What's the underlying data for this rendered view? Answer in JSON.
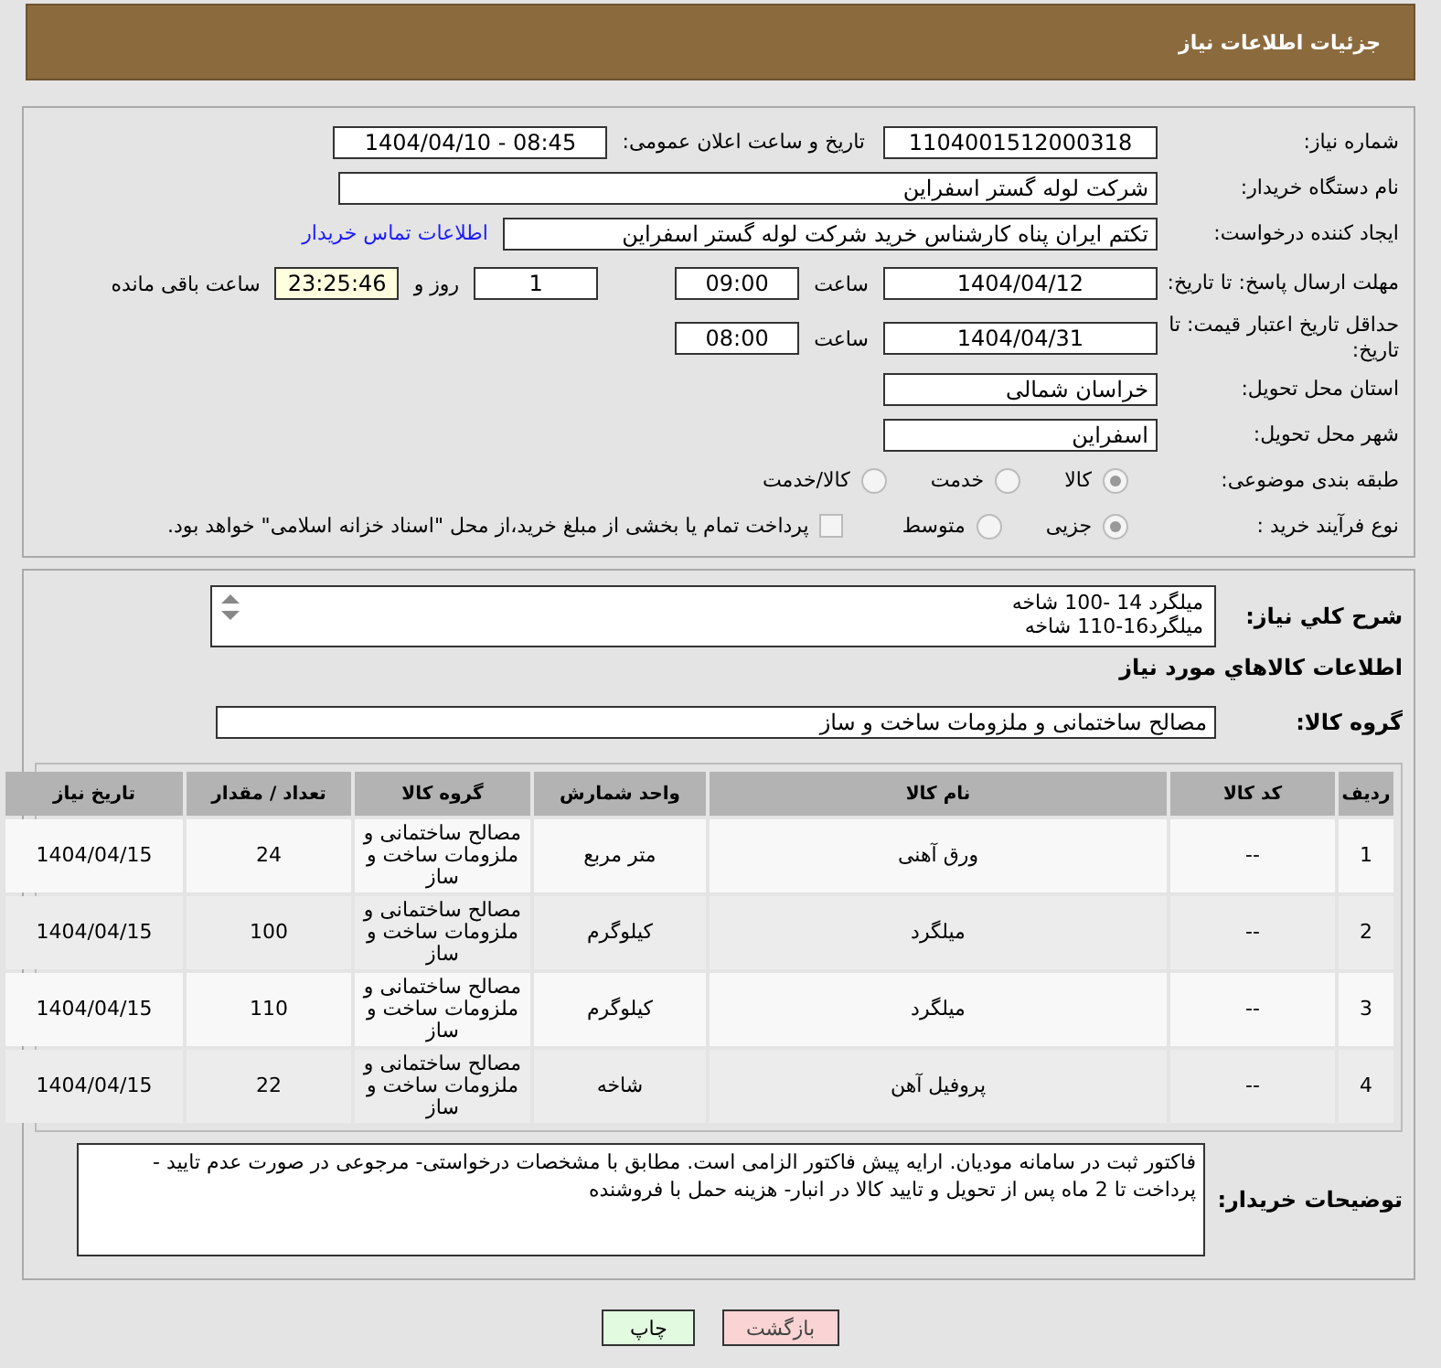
{
  "header": {
    "title": "جزئیات اطلاعات نیاز"
  },
  "need_number": {
    "label": "شماره نیاز:",
    "value": "1104001512000318"
  },
  "announce": {
    "label": "تاریخ و ساعت اعلان عمومی:",
    "value": "1404/04/10 - 08:45"
  },
  "buyer_org": {
    "label": "نام دستگاه خریدار:",
    "value": "شرکت لوله گستر اسفراین"
  },
  "requester": {
    "label": "ایجاد کننده درخواست:",
    "value": "تکتم ایران پناه کارشناس خرید شرکت لوله گستر اسفراین",
    "link": "اطلاعات تماس خریدار"
  },
  "deadline": {
    "label": "مهلت ارسال پاسخ: تا تاریخ:",
    "date": "1404/04/12",
    "time_label": "ساعت",
    "time": "09:00",
    "days": "1",
    "days_label": "روز و",
    "remaining": "23:25:46",
    "remaining_label": "ساعت باقی مانده"
  },
  "validity": {
    "label": "حداقل تاریخ اعتبار قیمت: تا تاریخ:",
    "date": "1404/04/31",
    "time_label": "ساعت",
    "time": "08:00"
  },
  "province": {
    "label": "استان محل تحویل:",
    "value": "خراسان شمالی"
  },
  "city": {
    "label": "شهر محل تحویل:",
    "value": "اسفراین"
  },
  "category": {
    "label": "طبقه بندی موضوعی:",
    "options": [
      {
        "label": "کالا",
        "selected": true
      },
      {
        "label": "خدمت",
        "selected": false
      },
      {
        "label": "کالا/خدمت",
        "selected": false
      }
    ]
  },
  "process": {
    "label": "نوع فرآیند خرید :",
    "options": [
      {
        "label": "جزیی",
        "selected": true
      },
      {
        "label": "متوسط",
        "selected": false
      }
    ],
    "treasury": {
      "label": "پرداخت تمام یا بخشی از مبلغ خرید،از محل \"اسناد خزانه اسلامی\" خواهد بود.",
      "checked": false
    }
  },
  "description": {
    "label": "شرح کلي نیاز:",
    "lines": [
      "میلگرد 14 -100 شاخه",
      "میلگرد16-110 شاخه"
    ]
  },
  "items_heading": "اطلاعات کالاهاي مورد نیاز",
  "goods_group": {
    "label": "گروه کالا:",
    "value": "مصالح ساختمانی و ملزومات ساخت و ساز"
  },
  "table": {
    "columns": [
      "ردیف",
      "کد کالا",
      "نام کالا",
      "واحد شمارش",
      "گروه کالا",
      "تعداد / مقدار",
      "تاریخ نیاز"
    ],
    "rows": [
      [
        "1",
        "--",
        "ورق آهنی",
        "متر مربع",
        "مصالح ساختمانی و ملزومات ساخت و ساز",
        "24",
        "1404/04/15"
      ],
      [
        "2",
        "--",
        "میلگرد",
        "کیلوگرم",
        "مصالح ساختمانی و ملزومات ساخت و ساز",
        "100",
        "1404/04/15"
      ],
      [
        "3",
        "--",
        "میلگرد",
        "کیلوگرم",
        "مصالح ساختمانی و ملزومات ساخت و ساز",
        "110",
        "1404/04/15"
      ],
      [
        "4",
        "--",
        "پروفیل آهن",
        "شاخه",
        "مصالح ساختمانی و ملزومات ساخت و ساز",
        "22",
        "1404/04/15"
      ]
    ]
  },
  "buyer_notes": {
    "label": "توضیحات خریدار:",
    "value": "فاکتور ثبت در سامانه مودیان. ارایه پیش فاکتور الزامی است. مطابق با مشخصات درخواستی- مرجوعی در صورت عدم تایید - پرداخت تا 2 ماه پس از تحویل و تایید کالا در انبار- هزینه حمل با فروشنده"
  },
  "buttons": [
    {
      "label": "بازگشت",
      "kind": "back"
    },
    {
      "label": "چاپ",
      "kind": "print"
    }
  ]
}
